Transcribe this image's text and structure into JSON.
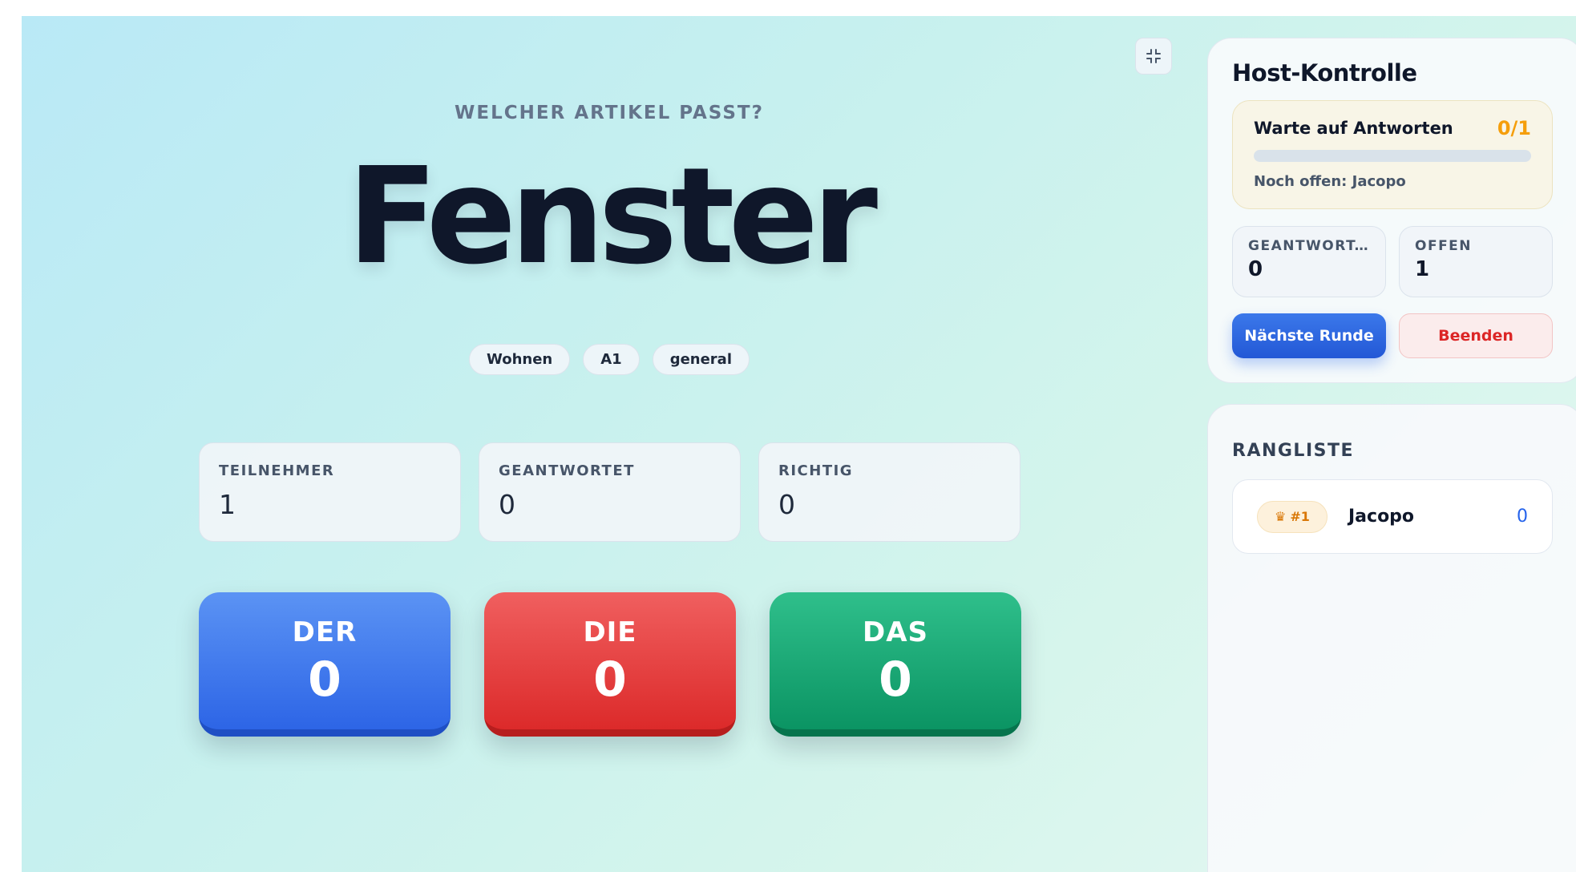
{
  "game": {
    "prompt": "WELCHER ARTIKEL PASST?",
    "word": "Fenster",
    "tags": [
      "Wohnen",
      "A1",
      "general"
    ],
    "stats": [
      {
        "label": "TEILNEHMER",
        "value": "1"
      },
      {
        "label": "GEANTWORTET",
        "value": "0"
      },
      {
        "label": "RICHTIG",
        "value": "0"
      }
    ],
    "answers": [
      {
        "article": "DER",
        "count": "0",
        "color": "#2d65e6"
      },
      {
        "article": "DIE",
        "count": "0",
        "color": "#dc2a2a"
      },
      {
        "article": "DAS",
        "count": "0",
        "color": "#0b9463"
      }
    ]
  },
  "host": {
    "title": "Host-Kontrolle",
    "waiting": {
      "title": "Warte auf Antworten",
      "fraction": "0/1",
      "progress": 0,
      "open_text": "Noch offen: Jacopo"
    },
    "mini_stats": [
      {
        "label": "GEANTWORT...",
        "value": "0"
      },
      {
        "label": "OFFEN",
        "value": "1"
      }
    ],
    "next_button": "Nächste Runde",
    "end_button": "Beenden"
  },
  "ranking": {
    "title": "RANGLISTE",
    "items": [
      {
        "badge_icon": "♛",
        "rank": "#1",
        "name": "Jacopo",
        "score": "0"
      }
    ]
  },
  "colors": {
    "accent_blue": "#2563eb",
    "warning_amber": "#f59e0b",
    "danger_red": "#dc2626"
  }
}
